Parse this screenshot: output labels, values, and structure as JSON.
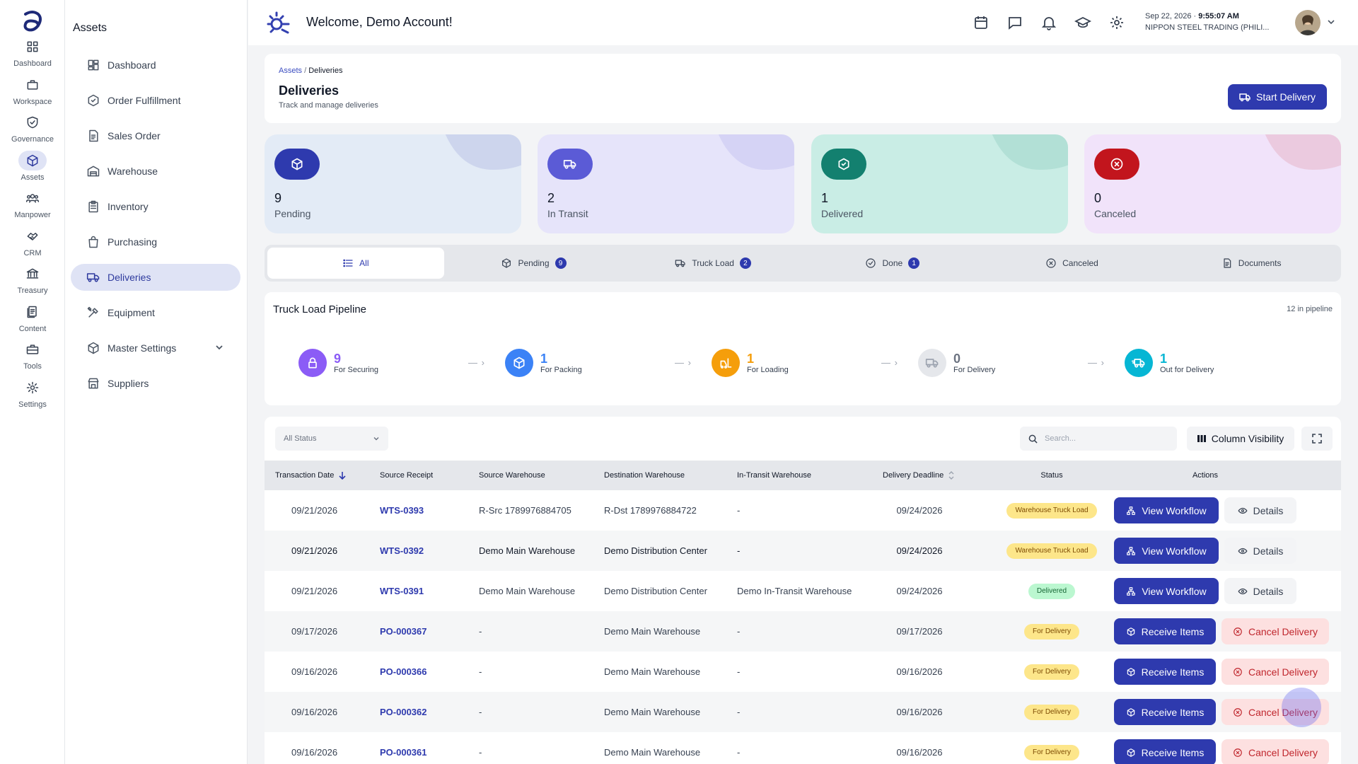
{
  "rail": [
    {
      "label": "Dashboard",
      "icon": "grid-icon"
    },
    {
      "label": "Workspace",
      "icon": "briefcase-icon"
    },
    {
      "label": "Governance",
      "icon": "shield-check-icon"
    },
    {
      "label": "Assets",
      "icon": "cube-icon",
      "active": true
    },
    {
      "label": "Manpower",
      "icon": "users-icon"
    },
    {
      "label": "CRM",
      "icon": "handshake-icon"
    },
    {
      "label": "Treasury",
      "icon": "bank-icon"
    },
    {
      "label": "Content",
      "icon": "documents-icon"
    },
    {
      "label": "Tools",
      "icon": "toolbox-icon"
    },
    {
      "label": "Settings",
      "icon": "gear-icon"
    }
  ],
  "sidebar": {
    "title": "Assets",
    "items": [
      {
        "label": "Dashboard",
        "icon": "dashboard-icon"
      },
      {
        "label": "Order Fulfillment",
        "icon": "box-check-icon"
      },
      {
        "label": "Sales Order",
        "icon": "document-icon"
      },
      {
        "label": "Warehouse",
        "icon": "warehouse-icon"
      },
      {
        "label": "Inventory",
        "icon": "clipboard-icon"
      },
      {
        "label": "Purchasing",
        "icon": "shopping-bag-icon"
      },
      {
        "label": "Deliveries",
        "icon": "truck-icon",
        "active": true
      },
      {
        "label": "Equipment",
        "icon": "tools-icon"
      },
      {
        "label": "Master Settings",
        "icon": "cube-icon"
      },
      {
        "label": "Suppliers",
        "icon": "store-icon"
      }
    ]
  },
  "topbar": {
    "welcome": "Welcome, Demo Account!",
    "date": "Sep 22, 2026",
    "time": "9:55:07 AM",
    "company": "NIPPON STEEL TRADING (PHILI..."
  },
  "header": {
    "breadcrumb_parent": "Assets",
    "breadcrumb_sep": "/",
    "breadcrumb_current": "Deliveries",
    "title": "Deliveries",
    "subtitle": "Track and manage deliveries",
    "start_button": "Start Delivery"
  },
  "stats": [
    {
      "value": "9",
      "label": "Pending",
      "bg": "#e3ebf6",
      "accent": "#2e3aae",
      "icon": "cube-icon"
    },
    {
      "value": "2",
      "label": "In Transit",
      "bg": "#e6e4fa",
      "accent": "#5b5bd6",
      "icon": "truck-icon"
    },
    {
      "value": "1",
      "label": "Delivered",
      "bg": "#c9ede5",
      "accent": "#13806f",
      "icon": "box-check-icon"
    },
    {
      "value": "0",
      "label": "Canceled",
      "bg": "#f1e3fa",
      "accent": "#c2151d",
      "icon": "x-circle-icon"
    }
  ],
  "tabs": [
    {
      "label": "All",
      "icon": "list-icon",
      "active": true
    },
    {
      "label": "Pending",
      "icon": "cube-icon",
      "badge": "9"
    },
    {
      "label": "Truck Load",
      "icon": "truck-icon",
      "badge": "2"
    },
    {
      "label": "Done",
      "icon": "check-circle-icon",
      "badge": "1"
    },
    {
      "label": "Canceled",
      "icon": "x-circle-icon"
    },
    {
      "label": "Documents",
      "icon": "document-icon"
    }
  ],
  "pipeline": {
    "title": "Truck Load Pipeline",
    "count": "12 in pipeline",
    "arrow": "— ›",
    "stages": [
      {
        "value": "9",
        "label": "For Securing",
        "color": "#8b5cf6",
        "icon": "lock-icon"
      },
      {
        "value": "1",
        "label": "For Packing",
        "color": "#3b82f6",
        "icon": "cube-icon"
      },
      {
        "value": "1",
        "label": "For Loading",
        "color": "#f59e0b",
        "icon": "forklift-icon"
      },
      {
        "value": "0",
        "label": "For Delivery",
        "color": "#e5e7eb",
        "icon": "truck-icon"
      },
      {
        "value": "1",
        "label": "Out for Delivery",
        "color": "#06b6d4",
        "icon": "truck-fast-icon"
      }
    ]
  },
  "table": {
    "status_filter": "All Status",
    "search_placeholder": "Search...",
    "column_visibility": "Column Visibility",
    "columns": [
      "Transaction Date",
      "Source Receipt",
      "Source Warehouse",
      "Destination Warehouse",
      "In-Transit Warehouse",
      "Delivery Deadline",
      "Status",
      "Actions"
    ],
    "rows": [
      {
        "date": "09/21/2026",
        "receipt": "WTS-0393",
        "source": "R-Src 1789976884705",
        "dest": "R-Dst 1789976884722",
        "transit": "-",
        "deadline": "09/24/2026",
        "status": "Warehouse Truck Load",
        "kind": "wtl",
        "btn1": "View Workflow",
        "btn2": "Details"
      },
      {
        "date": "09/21/2026",
        "receipt": "WTS-0392",
        "source": "Demo Main Warehouse",
        "dest": "Demo Distribution Center",
        "transit": "-",
        "deadline": "09/24/2026",
        "status": "Warehouse Truck Load",
        "kind": "wtl",
        "btn1": "View Workflow",
        "btn2": "Details"
      },
      {
        "date": "09/21/2026",
        "receipt": "WTS-0391",
        "source": "Demo Main Warehouse",
        "dest": "Demo Distribution Center",
        "transit": "Demo In-Transit Warehouse",
        "deadline": "09/24/2026",
        "status": "Delivered",
        "kind": "del",
        "btn1": "View Workflow",
        "btn2": "Details"
      },
      {
        "date": "09/17/2026",
        "receipt": "PO-000367",
        "source": "-",
        "dest": "Demo Main Warehouse",
        "transit": "-",
        "deadline": "09/17/2026",
        "status": "For Delivery",
        "kind": "fd",
        "btn1": "Receive Items",
        "btn2": "Cancel Delivery"
      },
      {
        "date": "09/16/2026",
        "receipt": "PO-000366",
        "source": "-",
        "dest": "Demo Main Warehouse",
        "transit": "-",
        "deadline": "09/16/2026",
        "status": "For Delivery",
        "kind": "fd",
        "btn1": "Receive Items",
        "btn2": "Cancel Delivery"
      },
      {
        "date": "09/16/2026",
        "receipt": "PO-000362",
        "source": "-",
        "dest": "Demo Main Warehouse",
        "transit": "-",
        "deadline": "09/16/2026",
        "status": "For Delivery",
        "kind": "fd",
        "btn1": "Receive Items",
        "btn2": "Cancel Delivery"
      },
      {
        "date": "09/16/2026",
        "receipt": "PO-000361",
        "source": "-",
        "dest": "Demo Main Warehouse",
        "transit": "-",
        "deadline": "09/16/2026",
        "status": "For Delivery",
        "kind": "fd",
        "btn1": "Receive Items",
        "btn2": "Cancel Delivery"
      }
    ]
  }
}
